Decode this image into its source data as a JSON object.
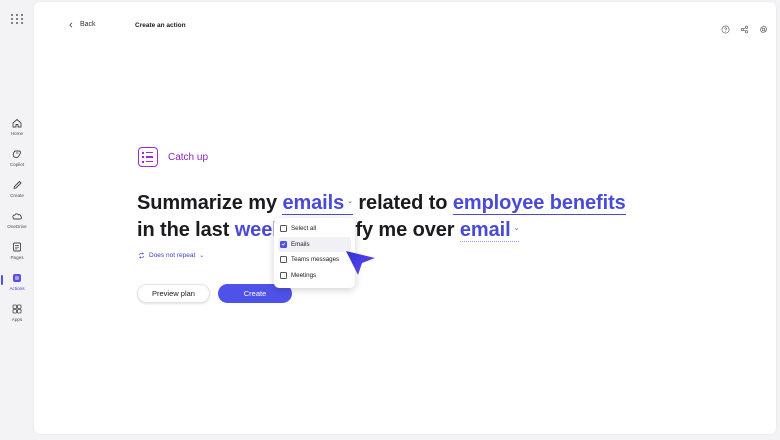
{
  "rail": {
    "items": [
      {
        "label": "Home",
        "icon": "home-icon"
      },
      {
        "label": "Copilot",
        "icon": "copilot-icon"
      },
      {
        "label": "Create",
        "icon": "pen-icon"
      },
      {
        "label": "OneDrive",
        "icon": "cloud-icon"
      },
      {
        "label": "Pages",
        "icon": "pages-icon"
      },
      {
        "label": "Actions",
        "icon": "actions-icon",
        "active": true
      },
      {
        "label": "Apps",
        "icon": "apps-icon"
      }
    ]
  },
  "header": {
    "back_label": "Back",
    "title": "Create an action"
  },
  "template": {
    "name": "Catch up"
  },
  "sentence": {
    "w1": "Summarize my",
    "source": "emails",
    "w2": "related to",
    "topic": "employee benefits",
    "w3": "in the last",
    "period": "week",
    "w4": "otify me over",
    "channel": "email"
  },
  "repeat_label": "Does not repeat",
  "dropdown": {
    "options": [
      {
        "label": "Select all",
        "checked": false
      },
      {
        "label": "Emails",
        "checked": true
      },
      {
        "label": "Teams messages",
        "checked": false
      },
      {
        "label": "Meetings",
        "checked": false
      }
    ]
  },
  "buttons": {
    "preview": "Preview plan",
    "create": "Create"
  },
  "colors": {
    "accent": "#4f52e8",
    "token": "#4a4ad8",
    "catchup": "#8a1fc2"
  }
}
